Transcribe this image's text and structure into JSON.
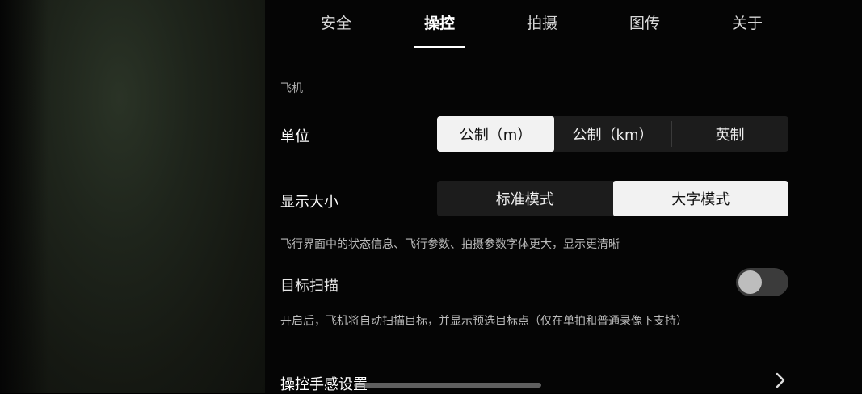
{
  "tabs": [
    {
      "label": "安全"
    },
    {
      "label": "操控"
    },
    {
      "label": "拍摄"
    },
    {
      "label": "图传"
    },
    {
      "label": "关于"
    }
  ],
  "active_tab": "操控",
  "section": {
    "header": "飞机"
  },
  "unit": {
    "label": "单位",
    "options": [
      "公制（m）",
      "公制（km）",
      "英制"
    ],
    "selected": "公制（m）"
  },
  "display_size": {
    "label": "显示大小",
    "options": [
      "标准模式",
      "大字模式"
    ],
    "selected": "大字模式",
    "description": "飞行界面中的状态信息、飞行参数、拍摄参数字体更大，显示更清晰"
  },
  "target_scan": {
    "label": "目标扫描",
    "enabled": false,
    "description": "开启后，飞机将自动扫描目标，并显示预选目标点（仅在单拍和普通录像下支持）"
  },
  "control_feel": {
    "label": "操控手感设置"
  },
  "icons": {
    "chevron": "chevron-right-icon"
  }
}
